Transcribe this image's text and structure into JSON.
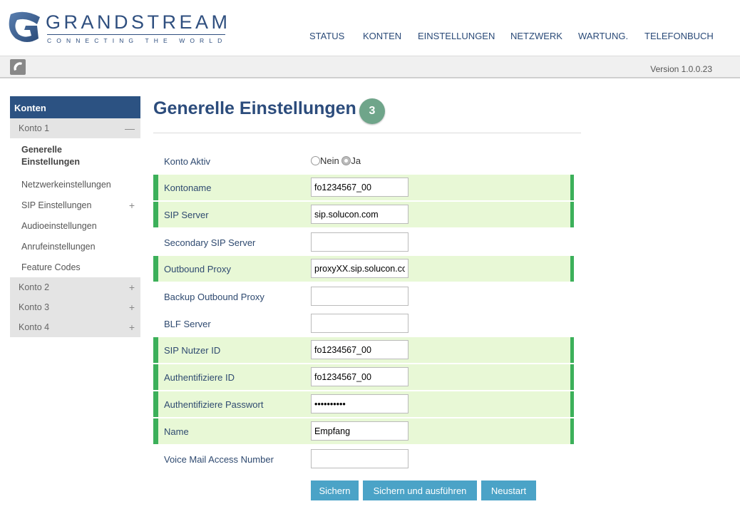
{
  "brand": {
    "name": "GRANDSTREAM",
    "tagline": "CONNECTING THE WORLD",
    "accent": "#2f4f7f"
  },
  "topnav": [
    {
      "label": "STATUS"
    },
    {
      "label": "KONTEN"
    },
    {
      "label": "EINSTELLUNGEN"
    },
    {
      "label": "NETZWERK"
    },
    {
      "label": "WARTUNG."
    },
    {
      "label": "TELEFONBUCH"
    }
  ],
  "subbar": {
    "icon": "phone-icon",
    "version": "Version 1.0.0.23"
  },
  "sidebar": {
    "header": "Konten",
    "account1": {
      "label": "Konto 1",
      "toggle": "minus-icon"
    },
    "items": [
      {
        "label": "Generelle Einstellungen",
        "active": true
      },
      {
        "label": "Netzwerkeinstellungen"
      },
      {
        "label": "SIP Einstellungen",
        "toggle": "plus-icon"
      },
      {
        "label": "Audioeinstellungen"
      },
      {
        "label": "Anrufeinstellungen"
      },
      {
        "label": "Feature Codes"
      }
    ],
    "accounts": [
      {
        "label": "Konto 2",
        "toggle": "plus-icon"
      },
      {
        "label": "Konto 3",
        "toggle": "plus-icon"
      },
      {
        "label": "Konto 4",
        "toggle": "plus-icon"
      }
    ]
  },
  "main": {
    "title": "Generelle Einstellungen",
    "step_badge": "3",
    "fields": {
      "konto_aktiv": {
        "label": "Konto Aktiv",
        "options": [
          "Nein",
          "Ja"
        ],
        "selected": "Ja"
      },
      "kontoname": {
        "label": "Kontoname",
        "value": "fo1234567_00",
        "highlighted": true
      },
      "sip_server": {
        "label": "SIP Server",
        "value": "sip.solucon.com",
        "highlighted": true
      },
      "secondary_sip_server": {
        "label": "Secondary SIP Server",
        "value": ""
      },
      "outbound_proxy": {
        "label": "Outbound Proxy",
        "value": "proxyXX.sip.solucon.com",
        "highlighted": true
      },
      "backup_outbound_proxy": {
        "label": "Backup Outbound Proxy",
        "value": ""
      },
      "blf_server": {
        "label": "BLF Server",
        "value": ""
      },
      "sip_nutzer_id": {
        "label": "SIP Nutzer ID",
        "value": "fo1234567_00",
        "highlighted": true
      },
      "auth_id": {
        "label": "Authentifiziere ID",
        "value": "fo1234567_00",
        "highlighted": true
      },
      "auth_passwort": {
        "label": "Authentifiziere Passwort",
        "value": "••••••••••",
        "highlighted": true
      },
      "name": {
        "label": "Name",
        "value": "Empfang",
        "highlighted": true
      },
      "voicemail": {
        "label": "Voice Mail Access Number",
        "value": ""
      }
    },
    "buttons": {
      "save": "Sichern",
      "save_apply": "Sichern und ausführen",
      "restart": "Neustart"
    }
  },
  "colors": {
    "highlight_bg": "#e8f8d6",
    "highlight_border": "#3cb05a",
    "button": "#4ba3c7",
    "sidebar_header": "#2c5282",
    "badge": "#6fa58a"
  }
}
